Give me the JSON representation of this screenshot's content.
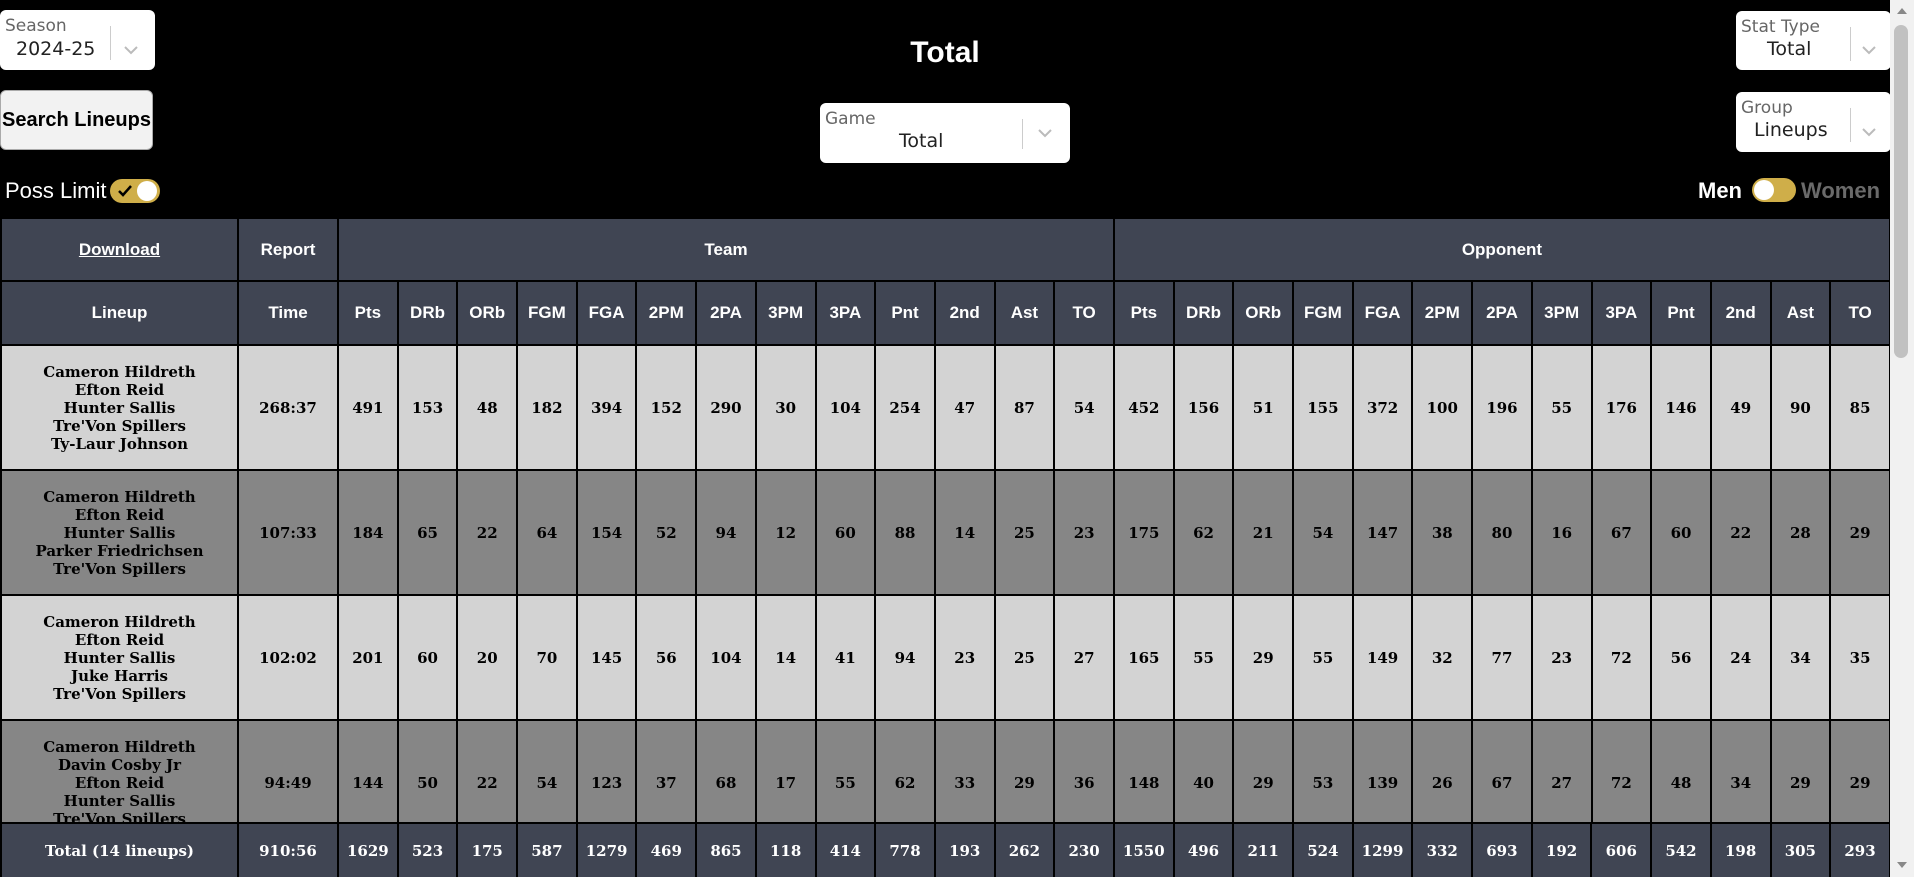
{
  "title": "Total",
  "season": {
    "label": "Season",
    "value": "2024-25"
  },
  "stat_type": {
    "label": "Stat Type",
    "value": "Total"
  },
  "group": {
    "label": "Group",
    "value": "Lineups"
  },
  "game": {
    "label": "Game",
    "value": "Total"
  },
  "search_button": "Search Lineups",
  "poss_limit_label": "Poss Limit",
  "gender": {
    "men": "Men",
    "women": "Women",
    "selected": "Men"
  },
  "colors": {
    "accent": "#cfae49",
    "header_bg": "#404553",
    "row_light": "#d3d3d3",
    "row_dark": "#868686"
  },
  "table": {
    "download": "Download",
    "report": "Report",
    "team": "Team",
    "opponent": "Opponent",
    "lineup_header": "Lineup",
    "time_header": "Time",
    "stat_headers": [
      "Pts",
      "DRb",
      "ORb",
      "FGM",
      "FGA",
      "2PM",
      "2PA",
      "3PM",
      "3PA",
      "Pnt",
      "2nd",
      "Ast",
      "TO"
    ],
    "rows": [
      {
        "lineup": [
          "Cameron Hildreth",
          "Efton Reid",
          "Hunter Sallis",
          "Tre'Von Spillers",
          "Ty-Laur Johnson"
        ],
        "time": "268:37",
        "team": [
          "491",
          "153",
          "48",
          "182",
          "394",
          "152",
          "290",
          "30",
          "104",
          "254",
          "47",
          "87",
          "54"
        ],
        "opp": [
          "452",
          "156",
          "51",
          "155",
          "372",
          "100",
          "196",
          "55",
          "176",
          "146",
          "49",
          "90",
          "85"
        ]
      },
      {
        "lineup": [
          "Cameron Hildreth",
          "Efton Reid",
          "Hunter Sallis",
          "Parker Friedrichsen",
          "Tre'Von Spillers"
        ],
        "time": "107:33",
        "team": [
          "184",
          "65",
          "22",
          "64",
          "154",
          "52",
          "94",
          "12",
          "60",
          "88",
          "14",
          "25",
          "23"
        ],
        "opp": [
          "175",
          "62",
          "21",
          "54",
          "147",
          "38",
          "80",
          "16",
          "67",
          "60",
          "22",
          "28",
          "29"
        ]
      },
      {
        "lineup": [
          "Cameron Hildreth",
          "Efton Reid",
          "Hunter Sallis",
          "Juke Harris",
          "Tre'Von Spillers"
        ],
        "time": "102:02",
        "team": [
          "201",
          "60",
          "20",
          "70",
          "145",
          "56",
          "104",
          "14",
          "41",
          "94",
          "23",
          "25",
          "27"
        ],
        "opp": [
          "165",
          "55",
          "29",
          "55",
          "149",
          "32",
          "77",
          "23",
          "72",
          "56",
          "24",
          "34",
          "35"
        ]
      },
      {
        "lineup": [
          "Cameron Hildreth",
          "Davin Cosby Jr",
          "Efton Reid",
          "Hunter Sallis",
          "Tre'Von Spillers"
        ],
        "time": "94:49",
        "team": [
          "144",
          "50",
          "22",
          "54",
          "123",
          "37",
          "68",
          "17",
          "55",
          "62",
          "33",
          "29",
          "36"
        ],
        "opp": [
          "148",
          "40",
          "29",
          "53",
          "139",
          "26",
          "67",
          "27",
          "72",
          "48",
          "34",
          "29",
          "29"
        ]
      }
    ],
    "total": {
      "label": "Total (14 lineups)",
      "time": "910:56",
      "team": [
        "1629",
        "523",
        "175",
        "587",
        "1279",
        "469",
        "865",
        "118",
        "414",
        "778",
        "193",
        "262",
        "230"
      ],
      "opp": [
        "1550",
        "496",
        "211",
        "524",
        "1299",
        "332",
        "693",
        "192",
        "606",
        "542",
        "198",
        "305",
        "293"
      ]
    }
  }
}
